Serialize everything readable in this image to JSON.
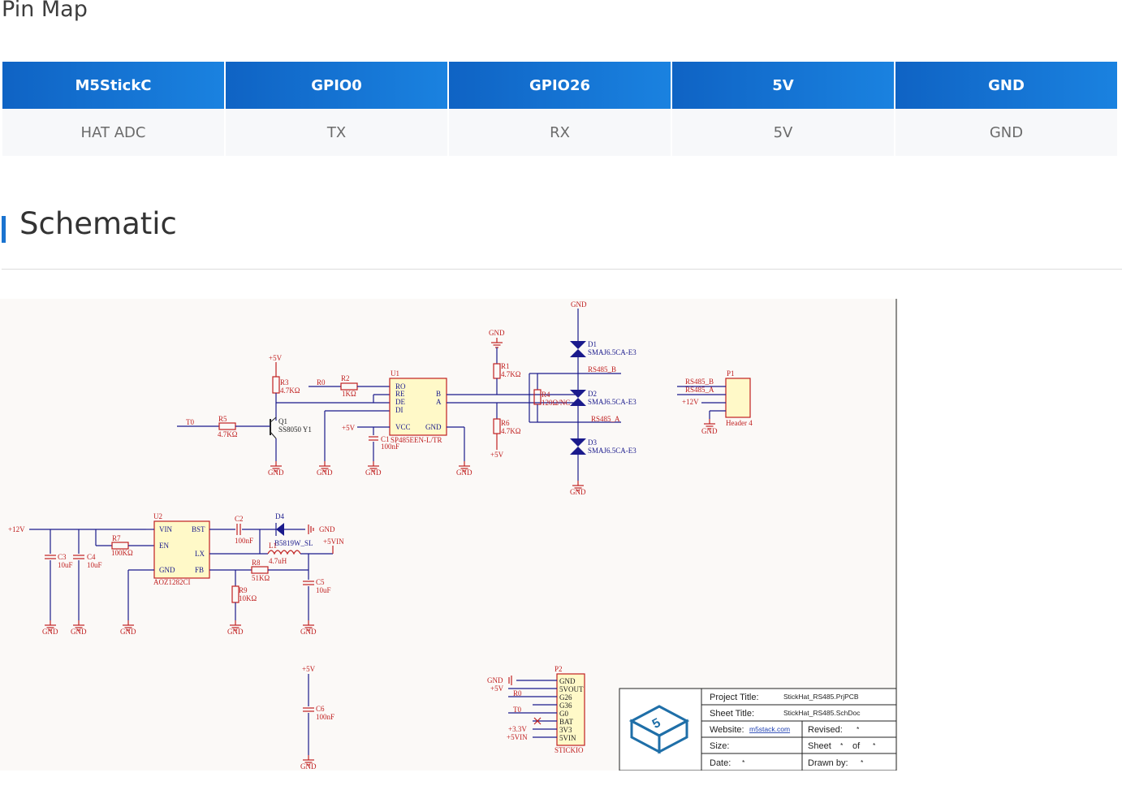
{
  "pin_map": {
    "title": "Pin Map",
    "headers": [
      "M5StickC",
      "GPIO0",
      "GPIO26",
      "5V",
      "GND"
    ],
    "row": [
      "HAT ADC",
      "TX",
      "RX",
      "5V",
      "GND"
    ]
  },
  "schematic_section": {
    "title": "Schematic"
  },
  "schematic": {
    "net_labels": {
      "gnd": "GND",
      "v5": "+5V",
      "v12": "+12V",
      "v5vin": "+5VIN",
      "v3v3": "+3.3V",
      "r0": "R0",
      "t0": "T0",
      "rs485b": "RS485_B",
      "rs485a": "RS485_A"
    },
    "components": {
      "r3": "R3",
      "r3v": "4.7KΩ",
      "r2": "R2",
      "r2v": "1KΩ",
      "r5": "R5",
      "r5v": "4.7KΩ",
      "q1": "Q1",
      "q1v": "SS8050 Y1",
      "u1": "U1",
      "u1v": "SP485EEN-L/TR",
      "u1_pins": [
        "RO",
        "RE",
        "DE",
        "DI",
        "VCC",
        "GND",
        "B",
        "A"
      ],
      "c1": "C1",
      "c1v": "100nF",
      "r1": "R1",
      "r1v": "4.7KΩ",
      "r4": "R4",
      "r4v": "120Ω/NC",
      "r6": "R6",
      "r6v": "4.7KΩ",
      "d1": "D1",
      "d1v": "SMAJ6.5CA-E3",
      "d2": "D2",
      "d2v": "SMAJ6.5CA-E3",
      "d3": "D3",
      "d3v": "SMAJ6.5CA-E3",
      "p1": "P1",
      "p1v": "Header 4",
      "u2": "U2",
      "u2v": "AOZ1282CI",
      "u2_pins": [
        "VIN",
        "BST",
        "EN",
        "LX",
        "GND",
        "FB"
      ],
      "c2": "C2",
      "c2v": "100nF",
      "d4": "D4",
      "d4v": "B5819W_SL",
      "l1": "L1",
      "l1v": "4.7uH",
      "r7": "R7",
      "r7v": "100KΩ",
      "r8": "R8",
      "r8v": "51KΩ",
      "r9": "R9",
      "r9v": "10KΩ",
      "c3": "C3",
      "c3v": "10uF",
      "c4": "C4",
      "c4v": "10uF",
      "c5": "C5",
      "c5v": "10uF",
      "c6": "C6",
      "c6v": "100nF",
      "p2": "P2",
      "p2v": "STICKIO",
      "p2_pins": [
        "GND",
        "5VOUT",
        "G26",
        "G36",
        "G0",
        "BAT",
        "3V3",
        "5VIN"
      ]
    },
    "title_block": {
      "project_title_label": "Project Title:",
      "project_title": "StickHat_RS485.PrjPCB",
      "sheet_title_label": "Sheet Title:",
      "sheet_title": "StickHat_RS485.SchDoc",
      "website_label": "Website:",
      "website": "m5stack.com",
      "revised_label": "Revised:",
      "revised": "*",
      "size_label": "Size:",
      "sheet_label": "Sheet",
      "sheet_num": "*",
      "of_label": "of",
      "sheet_total": "*",
      "date_label": "Date:",
      "date": "*",
      "drawn_by_label": "Drawn by:",
      "drawn_by": "*",
      "logo_char": "5"
    }
  }
}
